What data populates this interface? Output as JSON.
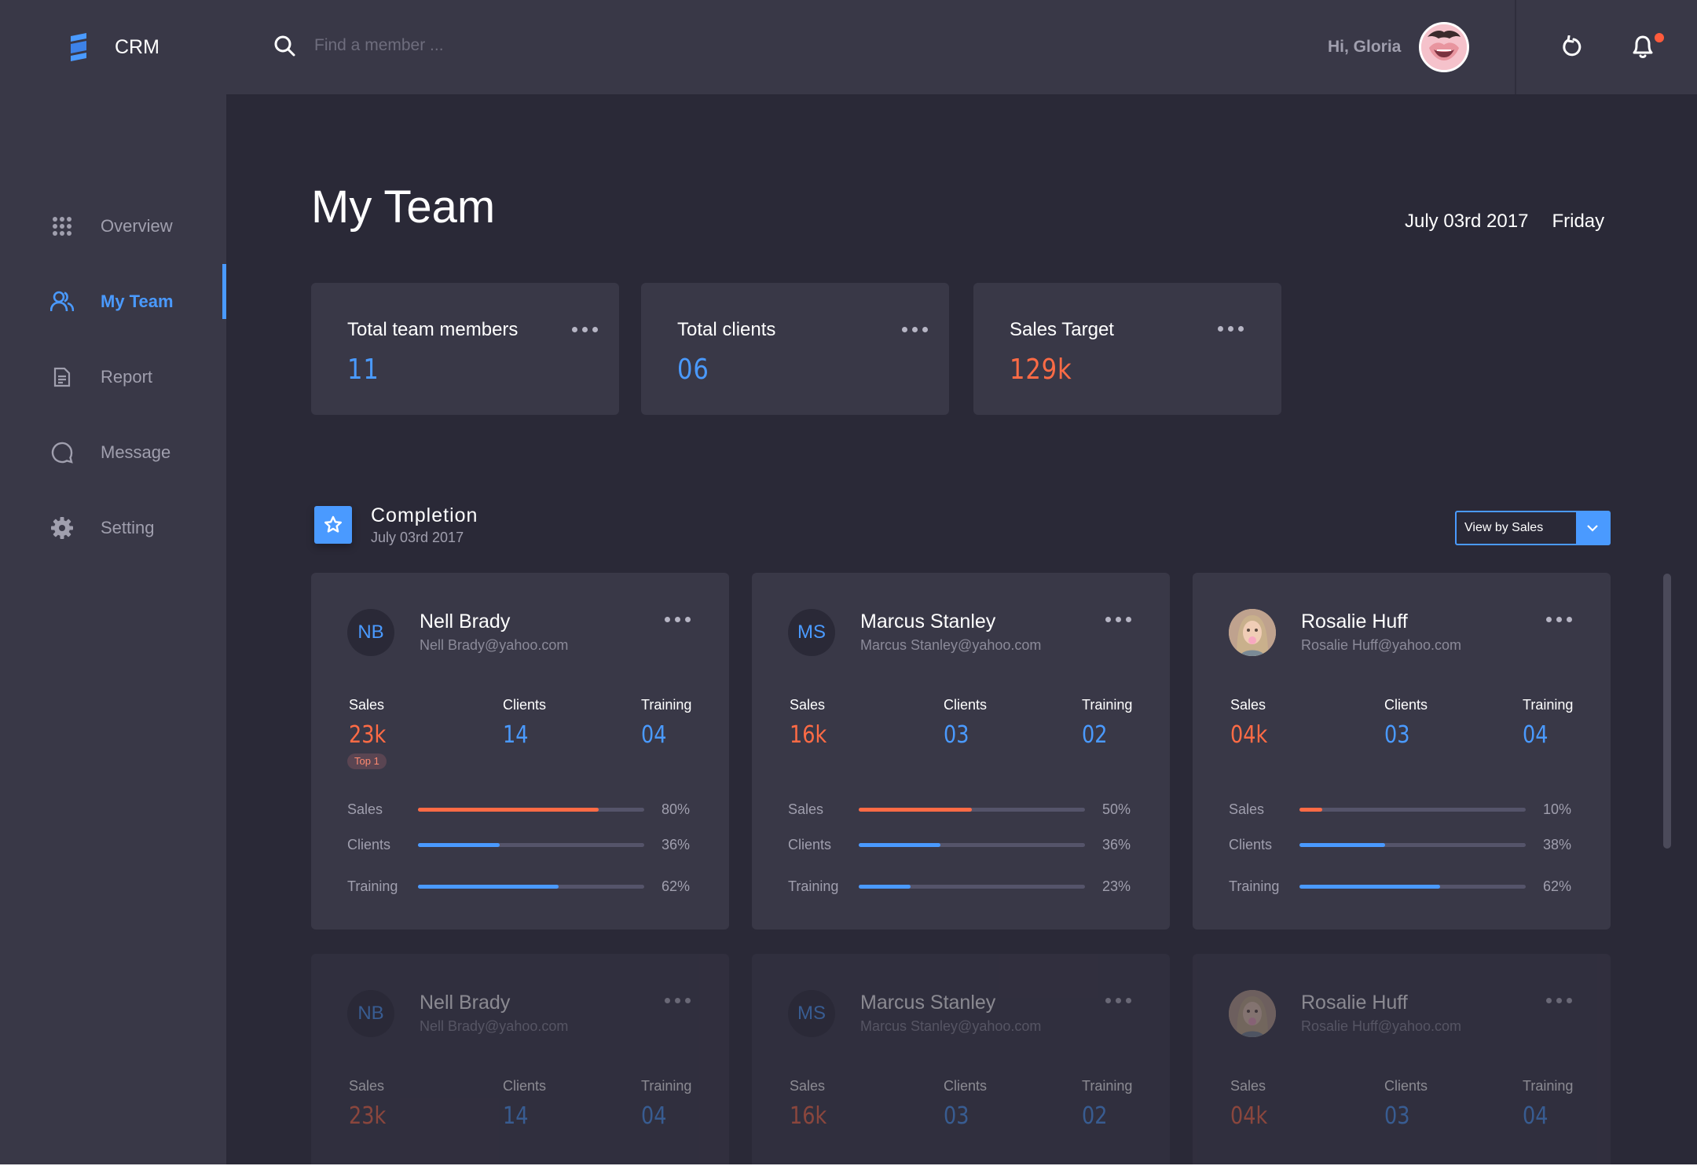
{
  "app": {
    "name": "CRM"
  },
  "sidebar": {
    "items": [
      {
        "label": "Overview",
        "icon": "grid-icon",
        "active": false
      },
      {
        "label": "My Team",
        "icon": "team-icon",
        "active": true
      },
      {
        "label": "Report",
        "icon": "document-icon",
        "active": false
      },
      {
        "label": "Message",
        "icon": "message-icon",
        "active": false
      },
      {
        "label": "Setting",
        "icon": "gear-icon",
        "active": false
      }
    ]
  },
  "header": {
    "search_placeholder": "Find a member ...",
    "greeting": "Hi, Gloria",
    "has_notification": true
  },
  "page": {
    "title": "My Team",
    "date": "July 03rd  2017",
    "weekday": "Friday"
  },
  "stats": [
    {
      "label": "Total team members",
      "value": "11",
      "color": "#4a9aff"
    },
    {
      "label": "Total clients",
      "value": "06",
      "color": "#4a9aff"
    },
    {
      "label": "Sales Target",
      "value": "129k",
      "color": "#ff6b45"
    }
  ],
  "completion": {
    "title": "Completion",
    "date": "July 03rd  2017",
    "view_select": "View by Sales"
  },
  "members": [
    {
      "initials": "NB",
      "name": "Nell Brady",
      "email": "Nell Brady@yahoo.com",
      "sales_label": "Sales",
      "sales": "23k",
      "clients_label": "Clients",
      "clients": "14",
      "training_label": "Training",
      "training": "04",
      "badge": "Top 1",
      "bars": [
        {
          "label": "Sales",
          "percent": 80,
          "pct_text": "80%"
        },
        {
          "label": "Clients",
          "percent": 36,
          "pct_text": "36%"
        },
        {
          "label": "Training",
          "percent": 62,
          "pct_text": "62%"
        }
      ]
    },
    {
      "initials": "MS",
      "name": "Marcus Stanley",
      "email": "Marcus Stanley@yahoo.com",
      "sales_label": "Sales",
      "sales": "16k",
      "clients_label": "Clients",
      "clients": "03",
      "training_label": "Training",
      "training": "02",
      "badge": "",
      "bars": [
        {
          "label": "Sales",
          "percent": 50,
          "pct_text": "50%"
        },
        {
          "label": "Clients",
          "percent": 36,
          "pct_text": "36%"
        },
        {
          "label": "Training",
          "percent": 23,
          "pct_text": "23%"
        }
      ]
    },
    {
      "initials": "",
      "name": "Rosalie Huff",
      "email": "Rosalie Huff@yahoo.com",
      "sales_label": "Sales",
      "sales": "04k",
      "clients_label": "Clients",
      "clients": "03",
      "training_label": "Training",
      "training": "04",
      "badge": "",
      "bars": [
        {
          "label": "Sales",
          "percent": 10,
          "pct_text": "10%"
        },
        {
          "label": "Clients",
          "percent": 38,
          "pct_text": "38%"
        },
        {
          "label": "Training",
          "percent": 62,
          "pct_text": "62%"
        }
      ]
    },
    {
      "initials": "NB",
      "name": "Nell Brady",
      "email": "Nell Brady@yahoo.com",
      "sales_label": "Sales",
      "sales": "23k",
      "clients_label": "Clients",
      "clients": "14",
      "training_label": "Training",
      "training": "04"
    },
    {
      "initials": "MS",
      "name": "Marcus Stanley",
      "email": "Marcus Stanley@yahoo.com",
      "sales_label": "Sales",
      "sales": "16k",
      "clients_label": "Clients",
      "clients": "03",
      "training_label": "Training",
      "training": "02"
    },
    {
      "initials": "",
      "name": "Rosalie Huff",
      "email": "Rosalie Huff@yahoo.com",
      "sales_label": "Sales",
      "sales": "04k",
      "clients_label": "Clients",
      "clients": "03",
      "training_label": "Training",
      "training": "04"
    }
  ],
  "colors": {
    "accent": "#4a9aff",
    "sales": "#ff6b45",
    "background": "#2a2937",
    "panel": "#393847"
  }
}
